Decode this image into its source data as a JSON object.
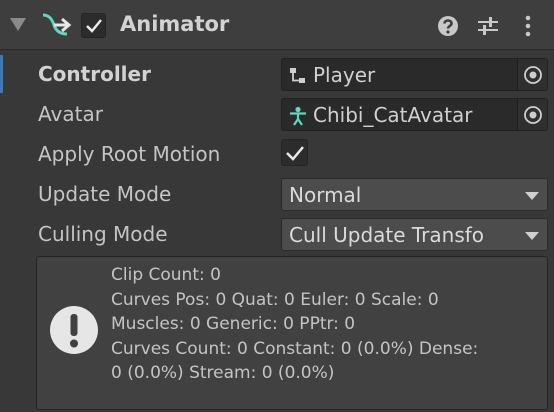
{
  "header": {
    "title": "Animator",
    "enabled": true,
    "foldout_icon": "triangle-down-icon",
    "component_icon": "animator-icon",
    "buttons": [
      "help-icon",
      "presets-icon",
      "kebab-menu-icon"
    ]
  },
  "fields": {
    "controller": {
      "label": "Controller",
      "value": "Player",
      "icon": "animator-controller-icon"
    },
    "avatar": {
      "label": "Avatar",
      "value": "Chibi_CatAvatar",
      "icon": "avatar-icon"
    },
    "apply_root_motion": {
      "label": "Apply Root Motion",
      "checked": true
    },
    "update_mode": {
      "label": "Update Mode",
      "value": "Normal"
    },
    "culling_mode": {
      "label": "Culling Mode",
      "value": "Cull Update Transfo"
    }
  },
  "info_box": {
    "icon": "warning-icon",
    "lines": [
      "Clip Count: 0",
      "Curves Pos: 0 Quat: 0 Euler: 0 Scale: 0",
      "Muscles: 0 Generic: 0 PPtr: 0",
      "Curves Count: 0 Constant: 0 (0.0%) Dense:",
      "0 (0.0%) Stream: 0 (0.0%)"
    ]
  },
  "colors": {
    "background": "#383838",
    "header": "#3e3e3e",
    "field": "#2a2a2a",
    "dropdown": "#4c4c4c",
    "accent": "#3a79bb",
    "animator_icon": "#5fd6c2"
  }
}
